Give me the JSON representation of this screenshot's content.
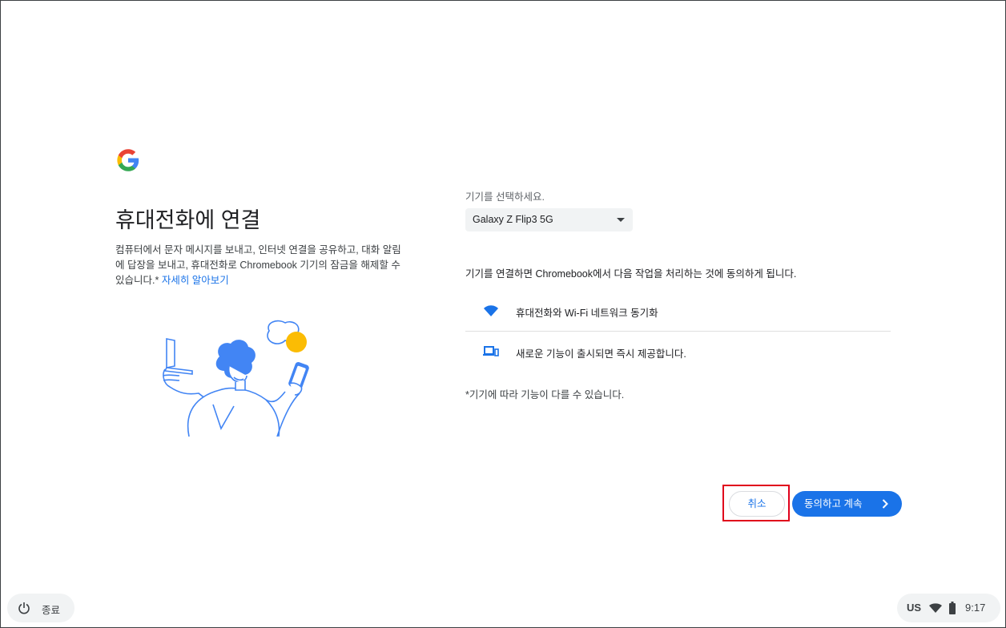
{
  "main": {
    "title": "휴대전화에 연결",
    "description": "컴퓨터에서 문자 메시지를 보내고, 인터넷 연결을 공유하고, 대화 알림에 답장을 보내고, 휴대전화로 Chromebook 기기의 잠금을 해제할 수 있습니다.*",
    "learn_more_link": "자세히 알아보기"
  },
  "device_select": {
    "label": "기기를 선택하세요.",
    "selected": "Galaxy Z Flip3 5G"
  },
  "consent": {
    "text": "기기를 연결하면 Chromebook에서 다음 작업을 처리하는 것에 동의하게 됩니다.",
    "features": [
      {
        "icon": "wifi-icon",
        "label": "휴대전화와 Wi-Fi 네트워크 동기화"
      },
      {
        "icon": "devices-icon",
        "label": "새로운 기능이 출시되면 즉시 제공합니다."
      }
    ],
    "note": "*기기에 따라 기능이 다를 수 있습니다."
  },
  "buttons": {
    "cancel": "취소",
    "continue": "동의하고 계속"
  },
  "shelf": {
    "shutdown_label": "종료",
    "ime": "US",
    "time": "9:17"
  },
  "colors": {
    "accent": "#1a73e8",
    "highlight": "#e0001b"
  }
}
